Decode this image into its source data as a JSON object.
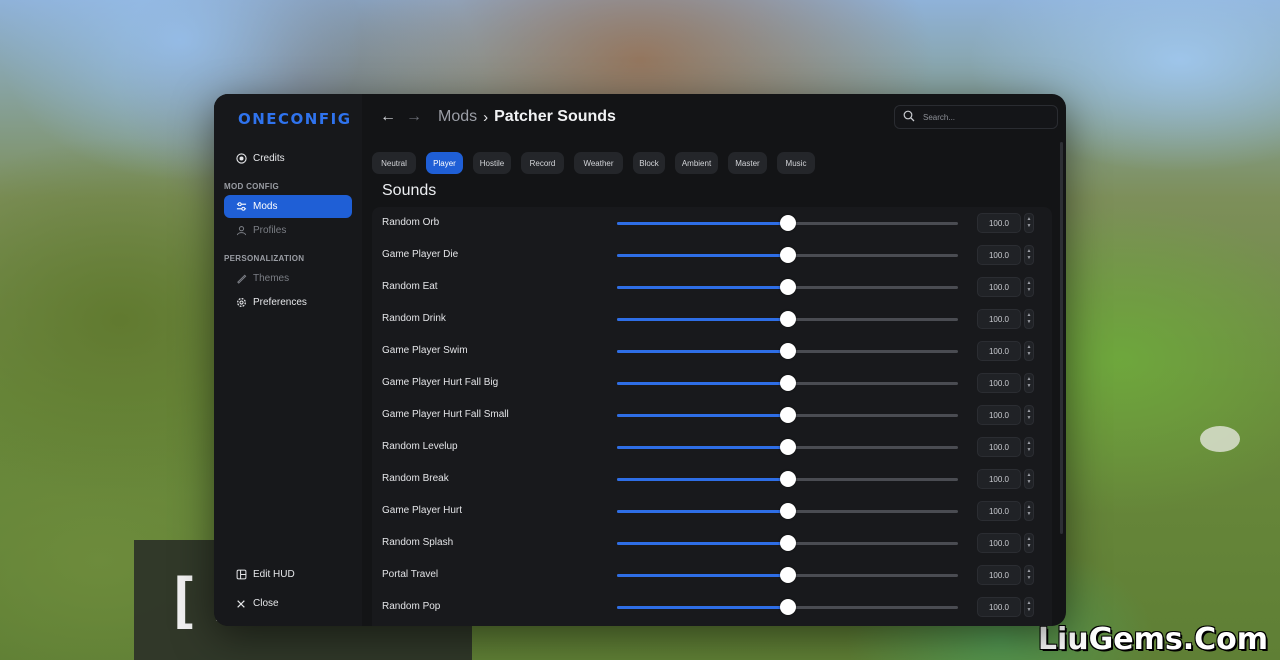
{
  "brand": {
    "name": "ONECONFIG"
  },
  "sidebar": {
    "credits": {
      "label": "Credits",
      "icon": "credits-icon"
    },
    "section_mod_config": "MOD CONFIG",
    "mods": {
      "label": "Mods",
      "icon": "sliders-icon",
      "active": true
    },
    "profiles": {
      "label": "Profiles",
      "icon": "user-icon"
    },
    "section_personalization": "PERSONALIZATION",
    "themes": {
      "label": "Themes",
      "icon": "brush-icon"
    },
    "preferences": {
      "label": "Preferences",
      "icon": "gear-icon"
    },
    "edit_hud": {
      "label": "Edit HUD",
      "icon": "layout-icon"
    },
    "close": {
      "label": "Close",
      "icon": "close-icon"
    }
  },
  "header": {
    "back": "←",
    "forward": "→",
    "crumb_parent": "Mods",
    "crumb_sep": "›",
    "title": "Patcher Sounds"
  },
  "search": {
    "placeholder": "Search..."
  },
  "tabs": [
    {
      "label": "Neutral",
      "active": false
    },
    {
      "label": "Player",
      "active": true
    },
    {
      "label": "Hostile",
      "active": false
    },
    {
      "label": "Record",
      "active": false
    },
    {
      "label": "Weather",
      "active": false
    },
    {
      "label": "Block",
      "active": false
    },
    {
      "label": "Ambient",
      "active": false
    },
    {
      "label": "Master",
      "active": false
    },
    {
      "label": "Music",
      "active": false
    }
  ],
  "section": {
    "title": "Sounds"
  },
  "slider_max": 200,
  "sounds": [
    {
      "label": "Random Orb",
      "value": "100.0",
      "level": 100
    },
    {
      "label": "Game Player Die",
      "value": "100.0",
      "level": 100
    },
    {
      "label": "Random Eat",
      "value": "100.0",
      "level": 100
    },
    {
      "label": "Random Drink",
      "value": "100.0",
      "level": 100
    },
    {
      "label": "Game Player Swim",
      "value": "100.0",
      "level": 100
    },
    {
      "label": "Game Player Hurt Fall Big",
      "value": "100.0",
      "level": 100
    },
    {
      "label": "Game Player Hurt Fall Small",
      "value": "100.0",
      "level": 100
    },
    {
      "label": "Random Levelup",
      "value": "100.0",
      "level": 100
    },
    {
      "label": "Random Break",
      "value": "100.0",
      "level": 100
    },
    {
      "label": "Game Player Hurt",
      "value": "100.0",
      "level": 100
    },
    {
      "label": "Random Splash",
      "value": "100.0",
      "level": 100
    },
    {
      "label": "Portal Travel",
      "value": "100.0",
      "level": 100
    },
    {
      "label": "Random Pop",
      "value": "100.0",
      "level": 100
    }
  ],
  "colors": {
    "accent": "#1f5fd6",
    "slider_fill": "#2e6ee6",
    "window_bg": "#131416"
  },
  "watermark": "LiuGems.Com",
  "background_sign": "[F"
}
